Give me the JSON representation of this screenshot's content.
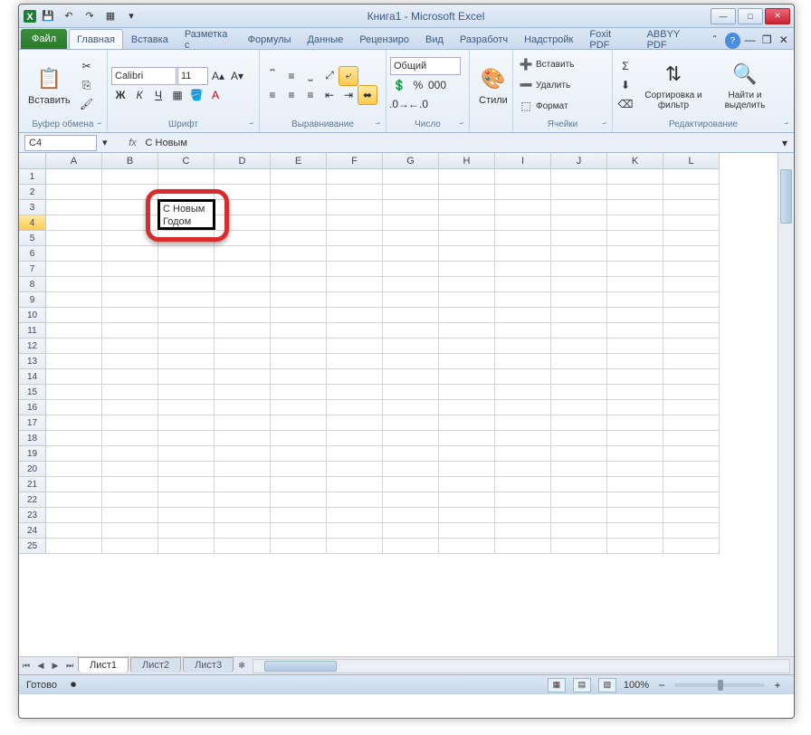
{
  "title": "Книга1  -  Microsoft Excel",
  "qat": {
    "save": "💾",
    "undo": "↶",
    "redo": "↷",
    "new": "▦"
  },
  "tabs": {
    "file": "Файл",
    "items": [
      "Главная",
      "Вставка",
      "Разметка с",
      "Формулы",
      "Данные",
      "Рецензиро",
      "Вид",
      "Разработч",
      "Надстройк",
      "Foxit PDF",
      "ABBYY PDF"
    ],
    "active": 0
  },
  "ribbon": {
    "clipboard": {
      "paste": "Вставить",
      "label": "Буфер обмена"
    },
    "font": {
      "name": "Calibri",
      "size": "11",
      "label": "Шрифт"
    },
    "align": {
      "label": "Выравнивание"
    },
    "number": {
      "format": "Общий",
      "label": "Число"
    },
    "styles": {
      "btn": "Стили"
    },
    "cells": {
      "insert": "Вставить",
      "delete": "Удалить",
      "format": "Формат",
      "label": "Ячейки"
    },
    "edit": {
      "sort": "Сортировка и фильтр",
      "find": "Найти и выделить",
      "label": "Редактирование"
    }
  },
  "namebox": "C4",
  "formula": "С Новым",
  "columns": [
    "A",
    "B",
    "C",
    "D",
    "E",
    "F",
    "G",
    "H",
    "I",
    "J",
    "K",
    "L"
  ],
  "rows": 25,
  "selRow": 4,
  "cellC3": "С Новым",
  "cellC4": "Годом",
  "sheets": {
    "active": "Лист1",
    "others": [
      "Лист2",
      "Лист3"
    ]
  },
  "status": {
    "ready": "Готово",
    "zoom": "100%"
  }
}
